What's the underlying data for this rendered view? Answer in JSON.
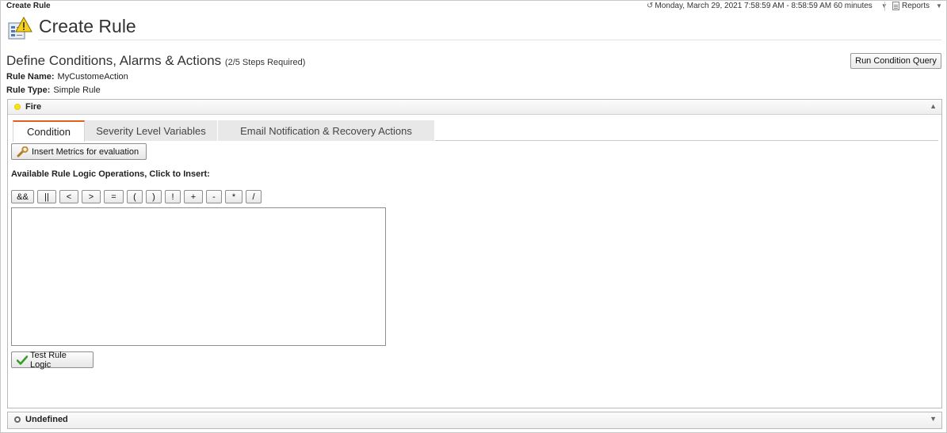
{
  "window": {
    "title": "Create Rule"
  },
  "topbar": {
    "time_range": "Monday, March 29, 2021 7:58:59 AM - 8:58:59 AM 60 minutes",
    "reports_label": "Reports"
  },
  "header": {
    "title": "Create Rule"
  },
  "section": {
    "title": "Define Conditions, Alarms & Actions",
    "steps": "(2/5 Steps Required)",
    "run_query_label": "Run Condition Query"
  },
  "rule": {
    "name_label": "Rule Name:",
    "name_value": "MyCustomeAction",
    "type_label": "Rule Type:",
    "type_value": "Simple Rule"
  },
  "fire_panel": {
    "label": "Fire",
    "status_color": "#f4e21b",
    "tabs": [
      {
        "label": "Condition",
        "active": true
      },
      {
        "label": "Severity Level Variables",
        "active": false
      },
      {
        "label": "Email Notification & Recovery Actions",
        "active": false
      }
    ],
    "insert_metrics_label": "Insert Metrics for evaluation",
    "operations_label": "Available Rule Logic Operations, Click to Insert:",
    "operations": [
      "&&",
      "||",
      "<",
      ">",
      "=",
      "(",
      ")",
      "!",
      "+",
      "-",
      "*",
      "/"
    ],
    "logic_value": "",
    "test_logic_label": "Test Rule Logic"
  },
  "undefined_panel": {
    "label": "Undefined"
  },
  "colors": {
    "active_tab_accent": "#e0601f",
    "check_green": "#3a9a2a"
  }
}
